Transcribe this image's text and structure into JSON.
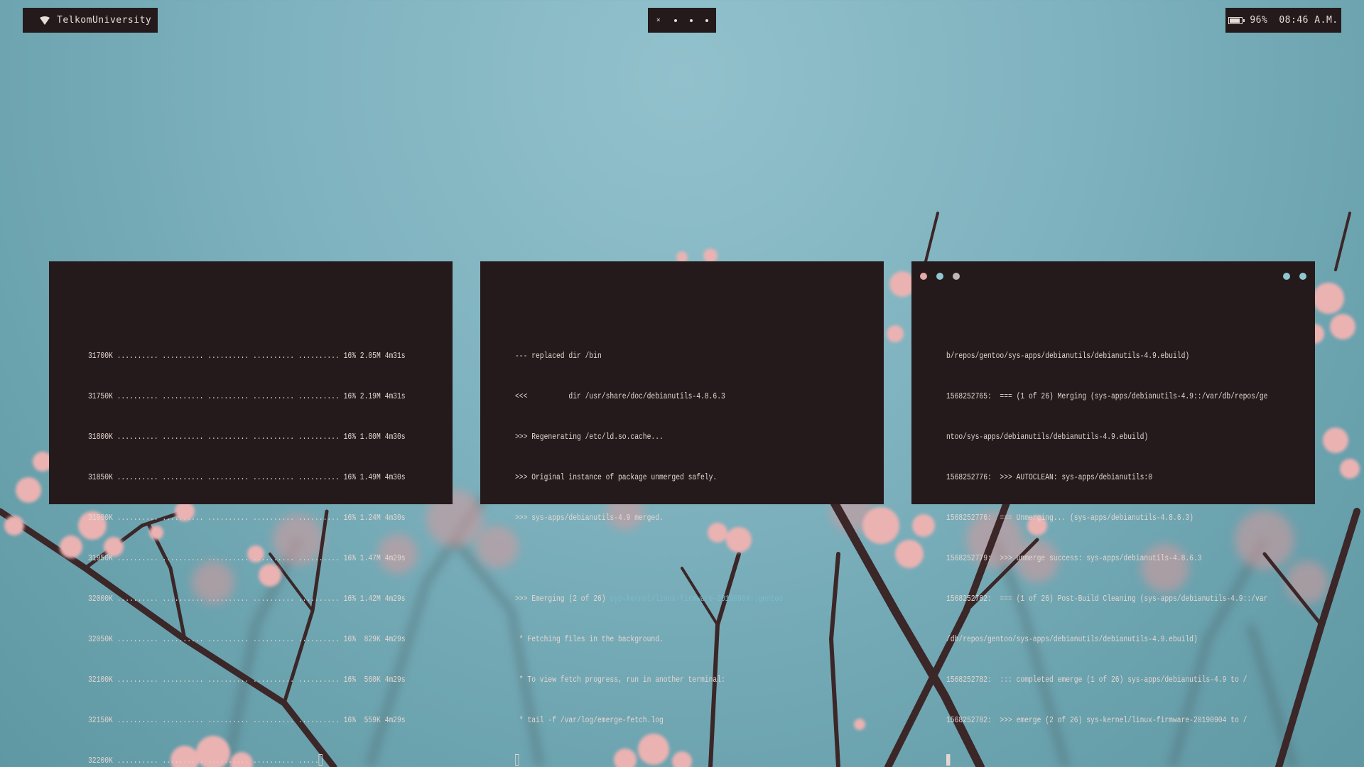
{
  "topbar": {
    "network_name": "TelkomUniversity",
    "network_icon": "wifi-icon",
    "workspaces": [
      {
        "glyph": "×",
        "active": true
      },
      {
        "glyph": "•",
        "active": false
      },
      {
        "glyph": "•",
        "active": false
      },
      {
        "glyph": "•",
        "active": false
      }
    ],
    "battery_icon": "battery-icon",
    "battery_level": "96%",
    "battery_fraction": 0.96,
    "clock": "08:46 A.M."
  },
  "terminals": [
    {
      "lines": [
        "31700K .......... .......... .......... .......... .......... 16% 2.05M 4m31s",
        "31750K .......... .......... .......... .......... .......... 16% 2.19M 4m31s",
        "31800K .......... .......... .......... .......... .......... 16% 1.80M 4m30s",
        "31850K .......... .......... .......... .......... .......... 16% 1.49M 4m30s",
        "31900K .......... .......... .......... .......... .......... 16% 1.24M 4m30s",
        "31950K .......... .......... .......... .......... .......... 16% 1.47M 4m29s",
        "32000K .......... .......... .......... .......... .......... 16% 1.42M 4m29s",
        "32050K .......... .......... .......... .......... .......... 16%  829K 4m29s",
        "32100K .......... .......... .......... .......... .......... 16%  560K 4m29s",
        "32150K .......... .......... .......... .......... .......... 16%  559K 4m29s",
        "32200K .......... .......... .......... .......... ....."
      ],
      "cursor": "box"
    },
    {
      "lines": [
        "--- replaced dir /bin",
        "<<<          dir /usr/share/doc/debianutils-4.8.6.3",
        ">>> Regenerating /etc/ld.so.cache...",
        ">>> Original instance of package unmerged safely.",
        ">>> sys-apps/debianutils-4.9 merged.",
        "",
        ">>> Emerging (2 of 26) ",
        " * Fetching files in the background.",
        " * To view fetch progress, run in another terminal:",
        " * tail -f /var/log/emerge-fetch.log"
      ],
      "emerging_package": "sys-kernel/linux-firmware-20190904::gentoo",
      "cursor": "box"
    },
    {
      "lines": [
        "b/repos/gentoo/sys-apps/debianutils/debianutils-4.9.ebuild)",
        "1568252765:  === (1 of 26) Merging (sys-apps/debianutils-4.9::/var/db/repos/ge",
        "ntoo/sys-apps/debianutils/debianutils-4.9.ebuild)",
        "1568252776:  >>> AUTOCLEAN: sys-apps/debianutils:0",
        "1568252776:  === Unmerging... (sys-apps/debianutils-4.8.6.3)",
        "1568252779:  >>> unmerge success: sys-apps/debianutils-4.8.6.3",
        "1568252782:  === (1 of 26) Post-Build Cleaning (sys-apps/debianutils-4.9::/var",
        "/db/repos/gentoo/sys-apps/debianutils/debianutils-4.9.ebuild)",
        "1568252782:  ::: completed emerge (1 of 26) sys-apps/debianutils-4.9 to /",
        "1568252782:  >>> emerge (2 of 26) sys-kernel/linux-firmware-20190904 to /"
      ],
      "cursor": "solid",
      "window_dots_left": [
        "#e6a8a8",
        "#8fc6d2",
        "#bfb6b6"
      ],
      "window_dots_right": [
        "#8fc6d2",
        "#8fc6d2"
      ]
    }
  ],
  "colors": {
    "panel_bg": "#241a1b",
    "panel_text": "#e4d6d1",
    "accent": "#7bbccc",
    "wallpaper_sky": "#7fb3bf",
    "blossom": "#e3a2a3",
    "branch": "#3b2628"
  }
}
